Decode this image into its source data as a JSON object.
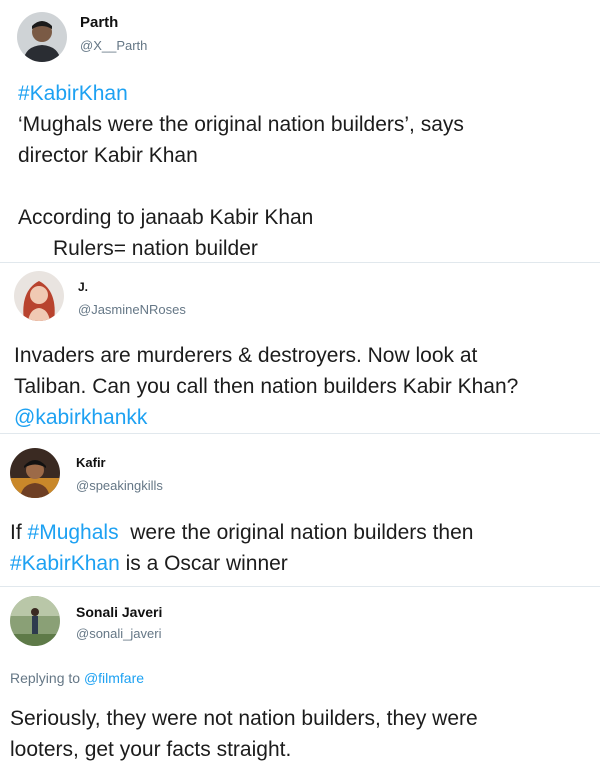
{
  "tweets": [
    {
      "name": "Parth",
      "handle": "@X__Parth",
      "lines": [
        {
          "parts": [
            {
              "t": "#KabirKhan",
              "link": true
            }
          ]
        },
        {
          "parts": [
            {
              "t": "‘Mughals were the original nation builders’, says"
            }
          ]
        },
        {
          "parts": [
            {
              "t": "director Kabir Khan"
            }
          ]
        },
        {
          "parts": [
            {
              "t": ""
            }
          ]
        },
        {
          "parts": [
            {
              "t": "According to janaab Kabir Khan"
            }
          ]
        },
        {
          "parts": [
            {
              "t": "      Rulers= nation builder"
            }
          ]
        }
      ]
    },
    {
      "name": "J.",
      "handle": "@JasmineNRoses",
      "lines": [
        {
          "parts": [
            {
              "t": "Invaders are murderers & destroyers. Now look at"
            }
          ]
        },
        {
          "parts": [
            {
              "t": "Taliban. Can you call then nation builders Kabir Khan?"
            }
          ]
        },
        {
          "parts": [
            {
              "t": "@kabirkhankk",
              "link": true
            }
          ]
        }
      ]
    },
    {
      "name": "Kafir",
      "handle": "@speakingkills",
      "lines": [
        {
          "parts": [
            {
              "t": "If "
            },
            {
              "t": "#Mughals",
              "link": true
            },
            {
              "t": "  were the original nation builders then"
            }
          ]
        },
        {
          "parts": [
            {
              "t": "#KabirKhan",
              "link": true
            },
            {
              "t": " is a Oscar winner"
            }
          ]
        }
      ]
    },
    {
      "name": "Sonali Javeri",
      "handle": "@sonali_javeri",
      "replying_prefix": "Replying to ",
      "replying_to": "@filmfare",
      "lines": [
        {
          "parts": [
            {
              "t": "Seriously, they were not nation builders, they were"
            }
          ]
        },
        {
          "parts": [
            {
              "t": "looters, get your facts straight."
            }
          ]
        }
      ]
    }
  ],
  "colors": {
    "link": "#1da1f2",
    "handle": "#657786",
    "divider": "#e1e8ed"
  }
}
